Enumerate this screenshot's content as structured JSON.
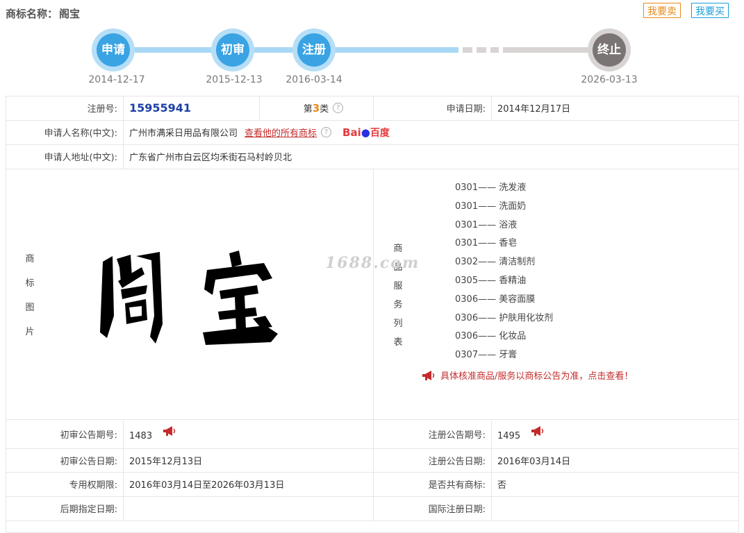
{
  "header": {
    "title_label": "商标名称：",
    "title_value": "阁宝",
    "sell_button": "我要卖",
    "buy_button": "我要买"
  },
  "timeline": {
    "steps": [
      {
        "label": "申请",
        "date": "2014-12-17"
      },
      {
        "label": "初审",
        "date": "2015-12-13"
      },
      {
        "label": "注册",
        "date": "2016-03-14"
      },
      {
        "label": "终止",
        "date": "2026-03-13"
      }
    ],
    "colors": {
      "active": "#3aa3e3",
      "inactive": "#7a7474"
    }
  },
  "info": {
    "reg_no_label": "注册号:",
    "reg_no": "15955941",
    "class_prefix": "第",
    "class_num": "3",
    "class_suffix": "类",
    "apply_date_label": "申请日期:",
    "apply_date": "2014年12月17日",
    "applicant_label": "申请人名称(中文):",
    "applicant": "广州市满采日用品有限公司",
    "all_marks_link": "查看他的所有商标",
    "baidu_text_1": "Bai",
    "baidu_text_2": "百度",
    "address_label": "申请人地址(中文):",
    "address": "广东省广州市白云区均禾街石马村岭贝北"
  },
  "image_section": {
    "label_chars": [
      "商",
      "标",
      "图",
      "片"
    ],
    "watermark": "1688.com",
    "mark_text": "阁宝"
  },
  "goods": {
    "label_chars": [
      "商",
      "品",
      "服",
      "务",
      "列",
      "表"
    ],
    "items": [
      "0301—— 洗发液",
      "0301—— 洗面奶",
      "0301—— 浴液",
      "0301—— 香皂",
      "0302—— 清洁制剂",
      "0305—— 香精油",
      "0306—— 美容面膜",
      "0306—— 护肤用化妆剂",
      "0306—— 化妆品",
      "0307—— 牙膏"
    ],
    "note": "具体核准商品/服务以商标公告为准，点击查看！"
  },
  "notice": {
    "prelim_no_label": "初审公告期号:",
    "prelim_no": "1483",
    "reg_notice_no_label": "注册公告期号:",
    "reg_notice_no": "1495",
    "prelim_date_label": "初审公告日期:",
    "prelim_date": "2015年12月13日",
    "reg_notice_date_label": "注册公告日期:",
    "reg_notice_date": "2016年03月14日",
    "exclusive_label": "专用权期限:",
    "exclusive": "2016年03月14日至2026年03月13日",
    "shared_label": "是否共有商标:",
    "shared": "否",
    "later_label": "后期指定日期:",
    "later": "",
    "intl_label": "国际注册日期:",
    "intl": ""
  }
}
